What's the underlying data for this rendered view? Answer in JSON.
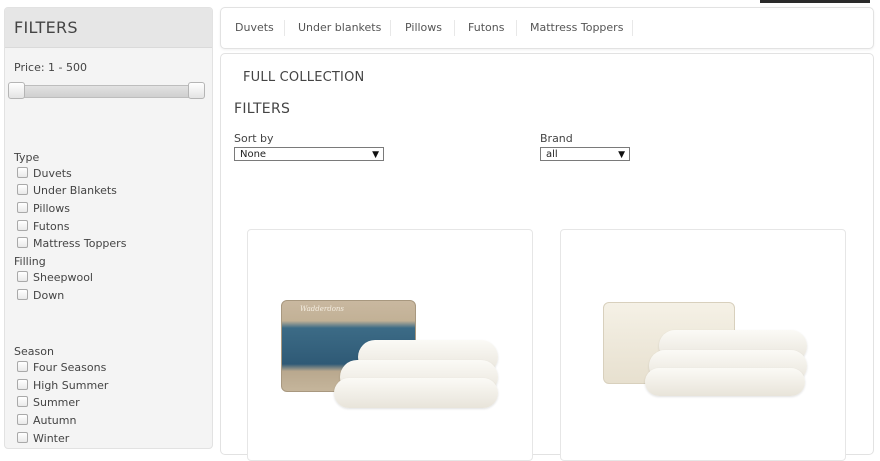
{
  "sidebar": {
    "title": "FILTERS",
    "price_label": "Price: 1 - 500",
    "groups": [
      {
        "title": "Type",
        "options": [
          "Duvets",
          "Under Blankets",
          "Pillows",
          "Futons",
          "Mattress Toppers"
        ]
      },
      {
        "title": "Filling",
        "options": [
          "Sheepwool",
          "Down"
        ]
      },
      {
        "title": "Season",
        "options": [
          "Four Seasons",
          "High Summer",
          "Summer",
          "Autumn",
          "Winter"
        ]
      }
    ]
  },
  "topnav": {
    "items": [
      "Duvets",
      "Under blankets",
      "Pillows",
      "Futons",
      "Mattress Toppers"
    ]
  },
  "main": {
    "collection_title": "FULL COLLECTION",
    "filters_title": "FILTERS",
    "sort": {
      "label": "Sort by",
      "value": "None"
    },
    "brand": {
      "label": "Brand",
      "value": "all"
    },
    "products": [
      {
        "bag_text": "Wadderdons"
      },
      {
        "bag_text": ""
      }
    ]
  }
}
